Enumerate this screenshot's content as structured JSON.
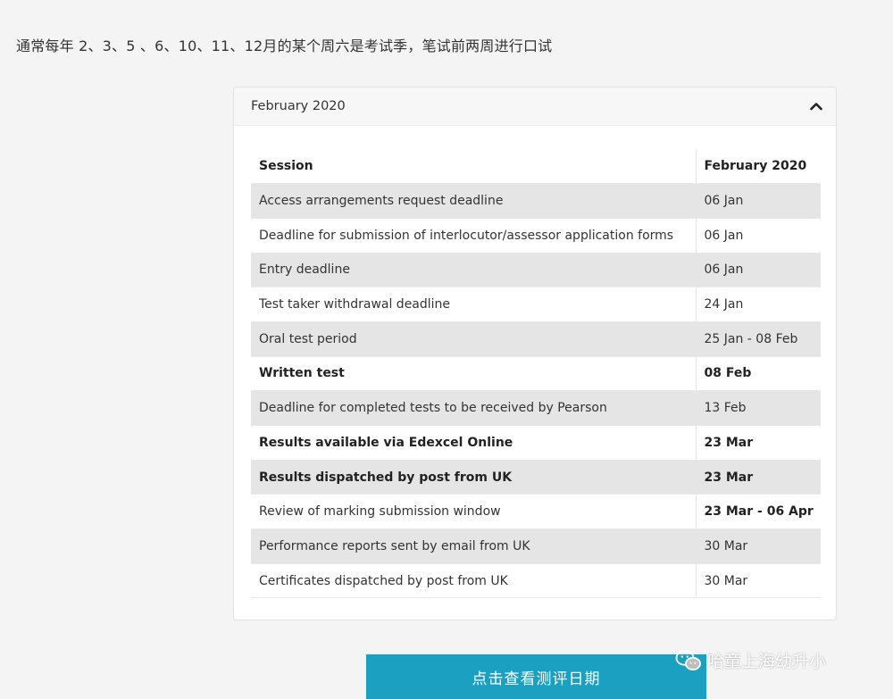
{
  "intro_text": "通常每年 2、3、5 、6、10、11、12月的某个周六是考试季，笔试前两周进行口试",
  "accordion": {
    "title": "February 2020",
    "expanded_icon": "chevron-up-icon"
  },
  "table": {
    "headers": [
      "Session",
      "February 2020"
    ],
    "rows": [
      {
        "session": "Access arrangements request deadline",
        "date": "06 Jan",
        "session_bold": false,
        "date_bold": false
      },
      {
        "session": "Deadline for submission of interlocutor/assessor application forms",
        "date": "06 Jan",
        "session_bold": false,
        "date_bold": false
      },
      {
        "session": "Entry deadline",
        "date": "06 Jan",
        "session_bold": false,
        "date_bold": false
      },
      {
        "session": "Test taker withdrawal deadline",
        "date": "24 Jan",
        "session_bold": false,
        "date_bold": false
      },
      {
        "session": "Oral test period",
        "date": "25 Jan - 08 Feb",
        "session_bold": false,
        "date_bold": false
      },
      {
        "session": "Written test",
        "date": "08 Feb",
        "session_bold": true,
        "date_bold": true
      },
      {
        "session": "Deadline for completed tests to be received by Pearson",
        "date": "13 Feb",
        "session_bold": false,
        "date_bold": false
      },
      {
        "session": "Results available via Edexcel Online",
        "date": "23 Mar",
        "session_bold": true,
        "date_bold": true
      },
      {
        "session": "Results dispatched by post from UK",
        "date": "23 Mar",
        "session_bold": true,
        "date_bold": true
      },
      {
        "session": "Review of marking submission window",
        "date": "23 Mar - 06 Apr",
        "session_bold": false,
        "date_bold": true
      },
      {
        "session": "Performance reports sent by email from UK",
        "date": "30 Mar",
        "session_bold": false,
        "date_bold": false
      },
      {
        "session": "Certificates dispatched by post from UK",
        "date": "30 Mar",
        "session_bold": false,
        "date_bold": false
      }
    ]
  },
  "cta_button": {
    "label": "点击查看测评日期"
  },
  "watermark": {
    "text": "哈童上海幼升小",
    "icon": "wechat-icon"
  },
  "colors": {
    "page_bg": "#f4f4f4",
    "stripe": "#e5e5e5",
    "cta": "#1ba0c2"
  }
}
